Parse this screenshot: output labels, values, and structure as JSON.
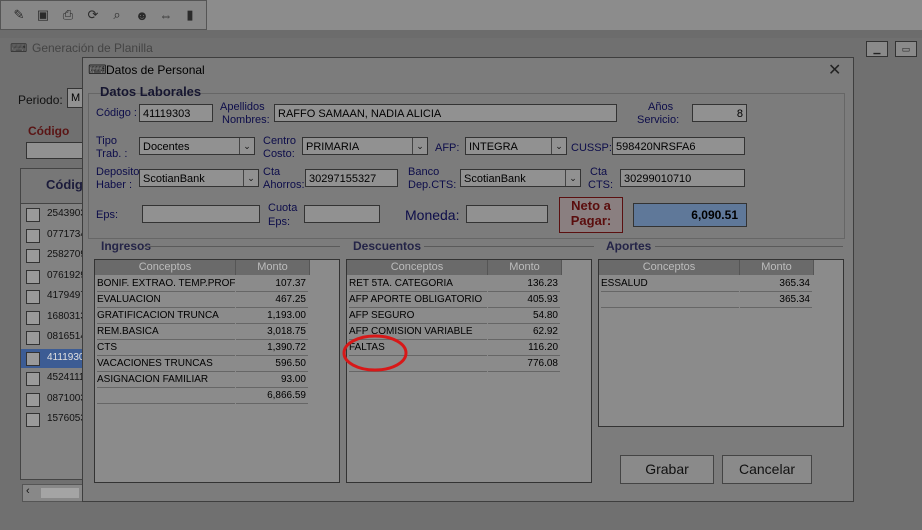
{
  "toolbar": {
    "icons": [
      "pencil-icon",
      "save-icon",
      "print-icon",
      "refresh-icon",
      "preview-icon",
      "user-search-icon",
      "tag-icon",
      "exit-door-icon"
    ]
  },
  "outer": {
    "title": "Generación de Planilla",
    "periodo_label": "Periodo:",
    "periodo_value": "M",
    "codigo_label": "Código",
    "grid_header": "Códig",
    "rows": [
      "2543903",
      "0771734",
      "2582709",
      "0761929",
      "4179497",
      "1680313",
      "0816514",
      "4111930",
      "4524111",
      "0871003",
      "1576053"
    ],
    "selected_row": 7
  },
  "dialog": {
    "title": "Datos de Personal",
    "close": "✕",
    "section_title": "Datos Laborales",
    "codigo_label": "Código :",
    "codigo_value": "41119303",
    "apellidos_label_1": "Apellidos",
    "apellidos_label_2": "Nombres:",
    "apellidos_value": "RAFFO SAMAAN, NADIA ALICIA",
    "anios_label_1": "Años",
    "anios_label_2": "Servicio:",
    "anios_value": "8",
    "tipo_label_1": "Tipo",
    "tipo_label_2": "Trab. :",
    "tipo_value": "Docentes",
    "centro_label_1": "Centro",
    "centro_label_2": "Costo:",
    "centro_value": "PRIMARIA",
    "afp_label": "AFP:",
    "afp_value": "INTEGRA",
    "cussp_label": "CUSSP:",
    "cussp_value": "598420NRSFA6",
    "deposito_label_1": "Deposito",
    "deposito_label_2": "Haber :",
    "deposito_value": "ScotianBank",
    "cta_ahorros_label_1": "Cta",
    "cta_ahorros_label_2": "Ahorros:",
    "cta_ahorros_value": "30297155327",
    "banco_label_1": "Banco",
    "banco_label_2": "Dep.CTS:",
    "banco_value": "ScotianBank",
    "cta_cts_label_1": "Cta",
    "cta_cts_label_2": "CTS:",
    "cta_cts_value": "30299010710",
    "eps_label": "Eps:",
    "eps_value": "",
    "cuota_label_1": "Cuota",
    "cuota_label_2": "Eps:",
    "cuota_value": "",
    "moneda_label": "Moneda:",
    "moneda_value": "",
    "neto_label_1": "Neto a",
    "neto_label_2": "Pagar:",
    "neto_value": "6,090.51",
    "col_conceptos": "Conceptos",
    "col_monto": "Monto",
    "ingresos": {
      "title": "Ingresos",
      "rows": [
        {
          "concepto": "BONIF. EXTRAO. TEMP.PROF",
          "monto": "107.37"
        },
        {
          "concepto": "EVALUACION",
          "monto": "467.25"
        },
        {
          "concepto": "GRATIFICACION TRUNCA",
          "monto": "1,193.00"
        },
        {
          "concepto": "REM.BASICA",
          "monto": "3,018.75"
        },
        {
          "concepto": "CTS",
          "monto": "1,390.72"
        },
        {
          "concepto": "VACACIONES TRUNCAS",
          "monto": "596.50"
        },
        {
          "concepto": "ASIGNACION FAMILIAR",
          "monto": "93.00"
        },
        {
          "concepto": "",
          "monto": "6,866.59"
        }
      ]
    },
    "descuentos": {
      "title": "Descuentos",
      "rows": [
        {
          "concepto": "RET 5TA. CATEGORIA",
          "monto": "136.23"
        },
        {
          "concepto": "AFP APORTE OBLIGATORIO",
          "monto": "405.93"
        },
        {
          "concepto": "AFP SEGURO",
          "monto": "54.80"
        },
        {
          "concepto": "AFP COMISION VARIABLE",
          "monto": "62.92"
        },
        {
          "concepto": "FALTAS",
          "monto": "116.20"
        },
        {
          "concepto": "",
          "monto": "776.08"
        }
      ]
    },
    "aportes": {
      "title": "Aportes",
      "rows": [
        {
          "concepto": "ESSALUD",
          "monto": "365.34"
        },
        {
          "concepto": "",
          "monto": "365.34"
        }
      ]
    },
    "grabar": "Grabar",
    "cancelar": "Cancelar"
  }
}
